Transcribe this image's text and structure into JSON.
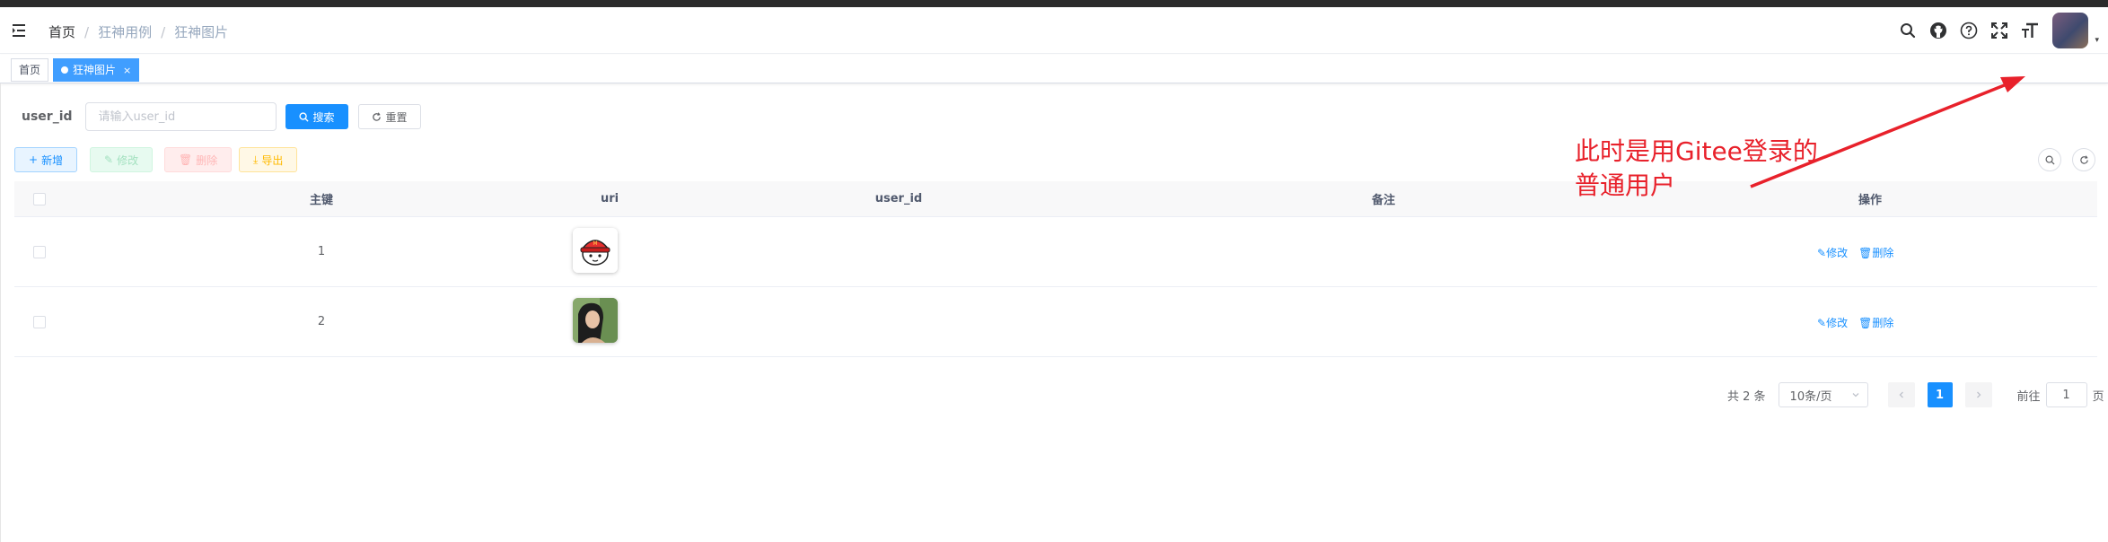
{
  "navbar": {
    "breadcrumb": [
      "首页",
      "狂神用例",
      "狂神图片"
    ],
    "separator": "/",
    "right_icons": [
      "search-icon",
      "github-icon",
      "help-icon",
      "fullscreen-icon",
      "font-size-icon"
    ],
    "avatar_caret": "▾"
  },
  "tags": {
    "home": "首页",
    "active": "狂神图片",
    "close": "×"
  },
  "search": {
    "label": "user_id",
    "placeholder": "请输入user_id",
    "search_label": "搜索",
    "reset_label": "重置"
  },
  "toolbar": {
    "add": "新增",
    "edit": "修改",
    "delete": "删除",
    "export": "导出"
  },
  "annotation": {
    "line1": "此时是用Gitee登录的",
    "line2": "普通用户",
    "color": "#e8212b"
  },
  "table": {
    "headers": {
      "id": "主键",
      "uri": "uri",
      "user_id": "user_id",
      "remark": "备注",
      "actions": "操作"
    },
    "rows": [
      {
        "id": "1",
        "uri": "image-1",
        "user_id": "",
        "remark": ""
      },
      {
        "id": "2",
        "uri": "image-2",
        "user_id": "",
        "remark": ""
      }
    ],
    "row_actions": {
      "edit": "修改",
      "delete": "删除"
    }
  },
  "pagination": {
    "total": "共 2 条",
    "page_size": "10条/页",
    "current": "1",
    "goto_prefix": "前往",
    "goto_value": "1",
    "goto_suffix": "页"
  },
  "colors": {
    "primary": "#1890ff",
    "success": "#13ce66",
    "danger": "#ff4949",
    "warning": "#ffba00"
  }
}
